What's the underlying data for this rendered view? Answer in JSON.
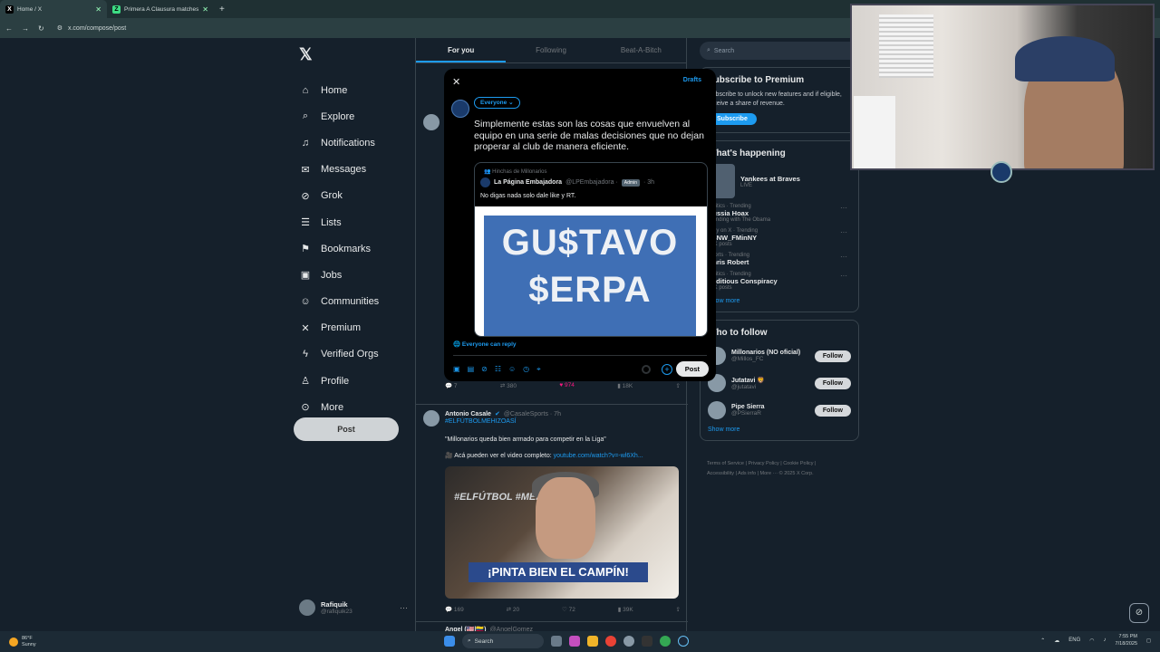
{
  "browser": {
    "tabs": [
      {
        "title": "Home / X",
        "close": "✕"
      },
      {
        "title": "Primera A Clausura matches | L",
        "close": "✕"
      }
    ],
    "new_tab": "+",
    "url": "x.com/compose/post"
  },
  "sidebar": {
    "items": [
      {
        "label": "Home",
        "icon": "home-icon"
      },
      {
        "label": "Explore",
        "icon": "search-icon"
      },
      {
        "label": "Notifications",
        "icon": "bell-icon"
      },
      {
        "label": "Messages",
        "icon": "mail-icon"
      },
      {
        "label": "Grok",
        "icon": "grok-icon"
      },
      {
        "label": "Lists",
        "icon": "list-icon"
      },
      {
        "label": "Bookmarks",
        "icon": "bookmark-icon"
      },
      {
        "label": "Jobs",
        "icon": "briefcase-icon"
      },
      {
        "label": "Communities",
        "icon": "people-icon"
      },
      {
        "label": "Premium",
        "icon": "x-icon"
      },
      {
        "label": "Verified Orgs",
        "icon": "lightning-icon"
      },
      {
        "label": "Profile",
        "icon": "person-icon"
      },
      {
        "label": "More",
        "icon": "more-circle-icon"
      }
    ],
    "post_label": "Post",
    "account": {
      "name": "Rafiquik",
      "handle": "@rafiquik23"
    }
  },
  "timeline": {
    "tabs": [
      "For you",
      "Following",
      "Beat-A-Bitch"
    ],
    "tweet1_actions": {
      "replies": "7",
      "reposts": "380",
      "likes": "974",
      "views": "18K"
    },
    "tweet2": {
      "name": "Antonio Casale",
      "handle": "@CasaleSports · 7h",
      "hashtag": "#ELFÚTBOLMEHIZOASÍ",
      "line1": "\"Millonarios queda bien armado para competir en la Liga\"",
      "line2": "🎥 Acá pueden ver el video completo:",
      "link": "youtube.com/watch?v=-wl6Xh...",
      "video_tag": "#ELFÚTBOL #MEHIZO ASÍ",
      "video_banner": "¡PINTA BIEN EL CAMPÍN!",
      "actions": {
        "replies": "169",
        "reposts": "20",
        "likes": "72",
        "views": "39K"
      }
    },
    "tweet3_name": "Angel (🇺🇸|🇨🇴)",
    "tweet3_handle": "@AngelGomez"
  },
  "right": {
    "search_placeholder": "Search",
    "premium": {
      "title": "Subscribe to Premium",
      "text": "Subscribe to unlock new features and if eligible, receive a share of revenue.",
      "button": "Subscribe"
    },
    "happening": {
      "title": "What's happening",
      "trends": [
        {
          "category": "",
          "name": "Yankees at Braves",
          "count": "LIVE"
        },
        {
          "category": "Politics · Trending",
          "name": "Russia Hoax",
          "count": "Trending with The Obama"
        },
        {
          "category": "Only on X · Trending",
          "name": "#BNW_FMinNY",
          "count": "12K posts"
        },
        {
          "category": "Sports · Trending",
          "name": "Chris Robert",
          "count": ""
        },
        {
          "category": "Politics · Trending",
          "name": "Seditious Conspiracy",
          "count": "12K posts"
        }
      ],
      "show_more": "Show more"
    },
    "who_to_follow": {
      "title": "Who to follow",
      "users": [
        {
          "name": "Millonarios (NO oficial)",
          "handle": "@Millos_FC",
          "button": "Follow"
        },
        {
          "name": "Jutatavi 🦁",
          "handle": "@jutatavi",
          "button": "Follow"
        },
        {
          "name": "Pipe Sierra",
          "handle": "@PSierraR",
          "button": "Follow"
        }
      ],
      "show_more": "Show more"
    },
    "footer": [
      "Terms of Service",
      "Privacy Policy",
      "Cookie Policy",
      "Accessibility",
      "Ads info",
      "More ···",
      "© 2025 X Corp."
    ]
  },
  "compose": {
    "close": "✕",
    "drafts": "Drafts",
    "audience": "Everyone ⌄",
    "text": "Simplemente estas son las cosas que envuelven al equipo en una serie de malas decisiones que no dejan properar al club de manera eficiente.",
    "quote": {
      "community": "Hinchas de Millonarios",
      "name": "La Página Embajadora",
      "handle": "@LPEmbajadora · ",
      "badge": "Admin",
      "time": "· 3h",
      "text": "No digas nada solo dale like y RT.",
      "img_line1": "GU$TAVO",
      "img_line2": "$ERPA"
    },
    "reply_setting": "Everyone can reply",
    "post_label": "Post"
  },
  "taskbar": {
    "temp": "86°F",
    "weather": "Sunny",
    "search": "Search",
    "lang": "ENG",
    "time": "7:55 PM",
    "date": "7/18/2025"
  }
}
